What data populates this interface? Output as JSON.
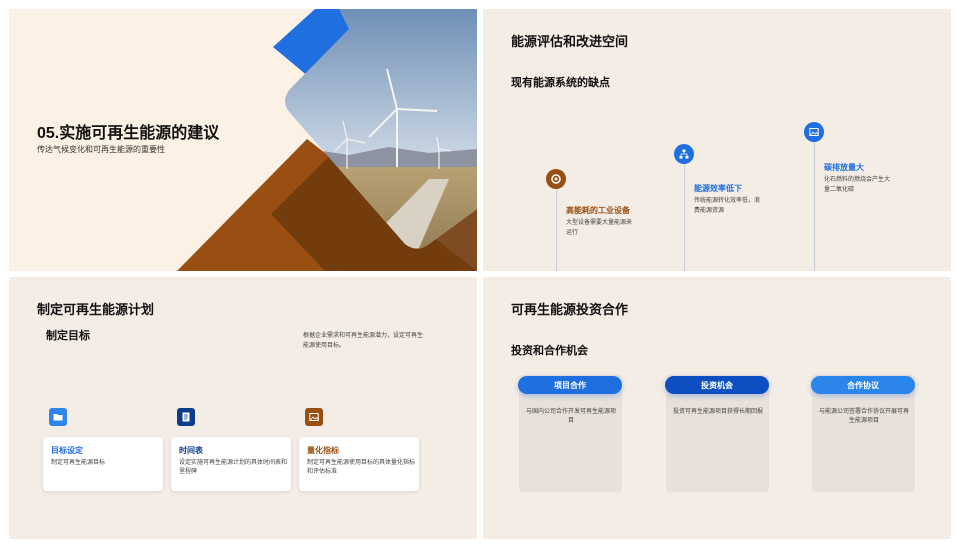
{
  "colors": {
    "blue": "#1f6fe0",
    "navy": "#0d3c8c",
    "brown": "#9a4f12",
    "cream": "#fcf1e5",
    "beige": "#f4ede6"
  },
  "slide1": {
    "title": "05.实施可再生能源的建议",
    "subtitle": "传达气候变化和可再生能源的重要性",
    "image": "wind-turbine-landscape"
  },
  "slide2": {
    "title": "能源评估和改进空间",
    "subtitle": "现有能源系统的缺点",
    "points": [
      {
        "title": "高能耗的工业设备",
        "desc": "大型设备需要大量能源来运行",
        "icon": "gear-icon",
        "color": "#9a4f12"
      },
      {
        "title": "能源效率低下",
        "desc": "传统能源转化效率低，浪费能源资源",
        "icon": "network-icon",
        "color": "#1f6fe0"
      },
      {
        "title": "碳排放量大",
        "desc": "化石燃料的燃烧会产生大量二氧化碳",
        "icon": "image-icon",
        "color": "#1f6fe0"
      }
    ]
  },
  "slide3": {
    "title": "制定可再生能源计划",
    "subtitle": "制定目标",
    "intro": "根据企业需求和可再生能源潜力，设定可再生能源使用目标。",
    "cards": [
      {
        "title": "目标设定",
        "desc": "制定可再生能源目标",
        "icon": "folder-icon",
        "color": "#1f6fe0"
      },
      {
        "title": "时间表",
        "desc": "设定实施可再生能源计划的具体时间表和里程碑",
        "icon": "document-icon",
        "color": "#0d3c8c"
      },
      {
        "title": "量化指标",
        "desc": "制定可再生能源使用目标的具体量化指标和评估标准",
        "icon": "image-icon",
        "color": "#9a4f12"
      }
    ]
  },
  "slide4": {
    "title": "可再生能源投资合作",
    "subtitle": "投资和合作机会",
    "items": [
      {
        "label": "项目合作",
        "desc": "与国内公司合作开发可再生能源项目",
        "color": "#1f6fe0"
      },
      {
        "label": "投资机会",
        "desc": "投资可再生能源项目获得长期回报",
        "color": "#0d4fc0"
      },
      {
        "label": "合作协议",
        "desc": "与能源公司签署合作协议开展可再生能源项目",
        "color": "#2b86ea"
      }
    ]
  }
}
